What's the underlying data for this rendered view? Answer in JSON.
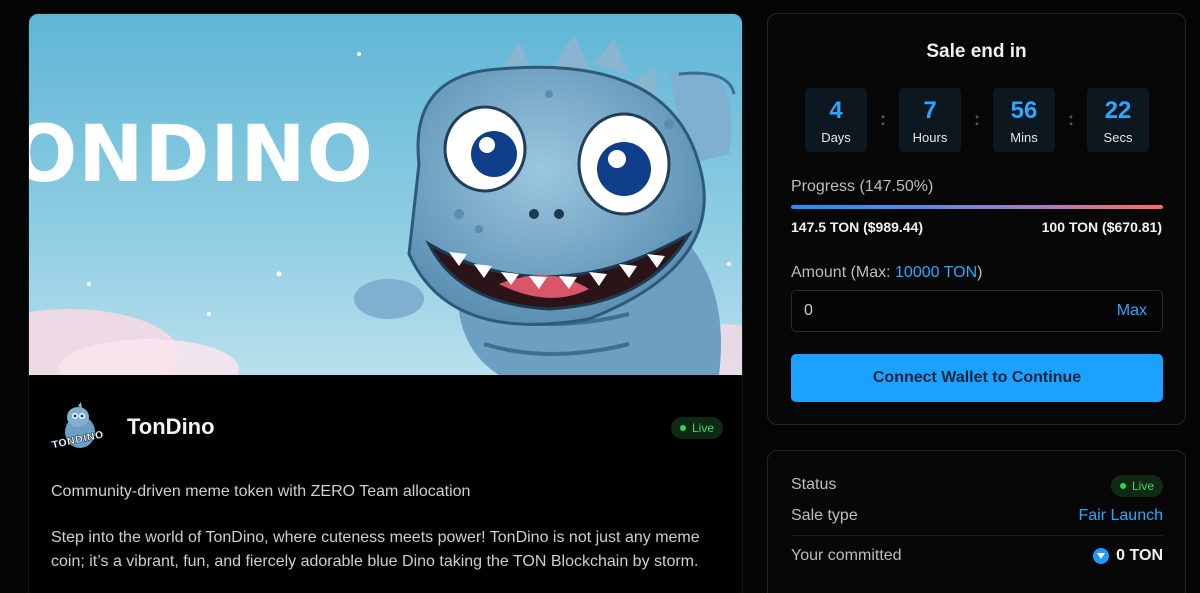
{
  "project": {
    "banner_title": "ONDINO",
    "name": "TonDino",
    "status_badge": "Live",
    "avatar_text": "TONDINO",
    "tagline": "Community-driven meme token with ZERO Team allocation",
    "description": "Step into the world of TonDino, where cuteness meets power! TonDino is not just any meme coin; it’s a vibrant, fun, and fiercely adorable blue Dino taking the TON Blockchain by storm."
  },
  "sale": {
    "title": "Sale end in",
    "countdown": [
      {
        "value": "4",
        "label": "Days"
      },
      {
        "value": "7",
        "label": "Hours"
      },
      {
        "value": "56",
        "label": "Mins"
      },
      {
        "value": "22",
        "label": "Secs"
      }
    ],
    "separator": ":",
    "progress_label": "Progress (147.50%)",
    "progress_percent": 147.5,
    "raised": "147.5 TON ($989.44)",
    "target": "100 TON ($670.81)",
    "amount_label": "Amount (Max: ",
    "amount_max": "10000 TON",
    "amount_label_end": ")",
    "amount_value": "0",
    "max_button": "Max",
    "connect_button": "Connect Wallet to Continue"
  },
  "info": {
    "status_key": "Status",
    "status_value": "Live",
    "sale_type_key": "Sale type",
    "sale_type_value": "Fair Launch",
    "committed_key": "Your committed",
    "committed_value": "0 TON"
  },
  "colors": {
    "accent": "#1ba1ff",
    "live_green": "#2fd35b",
    "banner_sky": "#7ec3de",
    "dino_blue": "#6fa7c9"
  }
}
